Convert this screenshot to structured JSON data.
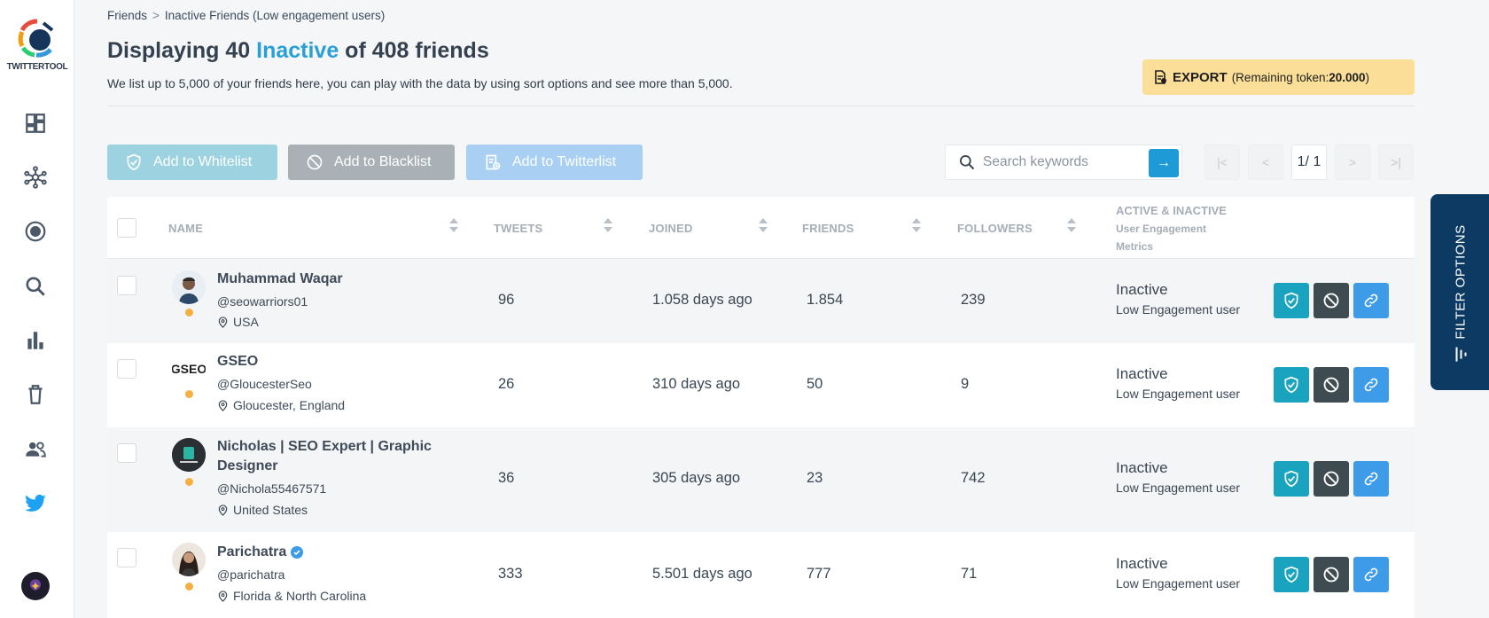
{
  "brand": {
    "logo_text": "TWITTERTOOL"
  },
  "sidebar": {
    "items": [
      {
        "icon": "dashboard-icon"
      },
      {
        "icon": "network-icon"
      },
      {
        "icon": "target-icon"
      },
      {
        "icon": "search-icon"
      },
      {
        "icon": "bar-chart-icon"
      },
      {
        "icon": "trash-icon"
      },
      {
        "icon": "users-icon"
      },
      {
        "icon": "twitter-icon"
      }
    ]
  },
  "breadcrumb": {
    "root": "Friends",
    "sep": ">",
    "current": "Inactive Friends (Low engagement users)"
  },
  "header": {
    "title_prefix": "Displaying 40 ",
    "title_highlight": "Inactive",
    "title_suffix": " of 408 friends",
    "subtitle": "We list up to 5,000 of your friends here, you can play with the data by using sort options and see more than 5,000."
  },
  "export": {
    "label": "EXPORT",
    "note_open": "(Remaining token: ",
    "tokens": "20.000",
    "note_close": ")"
  },
  "actions": {
    "whitelist": "Add to Whitelist",
    "blacklist": "Add to Blacklist",
    "twitterlist": "Add to Twitterlist"
  },
  "search": {
    "placeholder": "Search keywords",
    "go": "→"
  },
  "pagination": {
    "first": "|<",
    "prev": "<",
    "current": "1/ 1",
    "next": ">",
    "last": ">|"
  },
  "table": {
    "columns": {
      "name": "NAME",
      "tweets": "TWEETS",
      "joined": "JOINED",
      "friends": "FRIENDS",
      "followers": "FOLLOWERS",
      "status_title": "ACTIVE & INACTIVE",
      "status_sub1": "User Engagement",
      "status_sub2": "Metrics"
    },
    "rows": [
      {
        "name": "Muhammad Waqar",
        "name2": "",
        "handle": "@seowarriors01",
        "location": "USA",
        "tweets": "96",
        "joined": "1.058 days ago",
        "friends": "1.854",
        "followers": "239",
        "status": "Inactive",
        "engagement": "Low Engagement user"
      },
      {
        "name": "GSEO",
        "name2": "",
        "handle": "@GloucesterSeo",
        "location": "Gloucester, England",
        "tweets": "26",
        "joined": "310 days ago",
        "friends": "50",
        "followers": "9",
        "status": "Inactive",
        "engagement": "Low Engagement user",
        "avatar_text": "GSEO"
      },
      {
        "name": "Nicholas | SEO Expert | Graphic",
        "name2": "Designer",
        "handle": "@Nichola55467571",
        "location": "United States",
        "tweets": "36",
        "joined": "305 days ago",
        "friends": "23",
        "followers": "742",
        "status": "Inactive",
        "engagement": "Low Engagement user"
      },
      {
        "name": "Parichatra",
        "name2": "",
        "handle": "@parichatra",
        "location": "Florida & North Carolina",
        "tweets": "333",
        "joined": "5.501 days ago",
        "friends": "777",
        "followers": "71",
        "status": "Inactive",
        "engagement": "Low Engagement user",
        "verified": true
      }
    ]
  },
  "filter_tab": {
    "label": "FILTER OPTIONS"
  },
  "colors": {
    "accent": "#2a9fd6",
    "whitelist": "#1aa3bf",
    "blacklist": "#3e4c51",
    "link": "#3e9be8",
    "filter_tab": "#0c3a63",
    "export_bg": "#fbdf99",
    "status_dot": "#f5b041"
  }
}
